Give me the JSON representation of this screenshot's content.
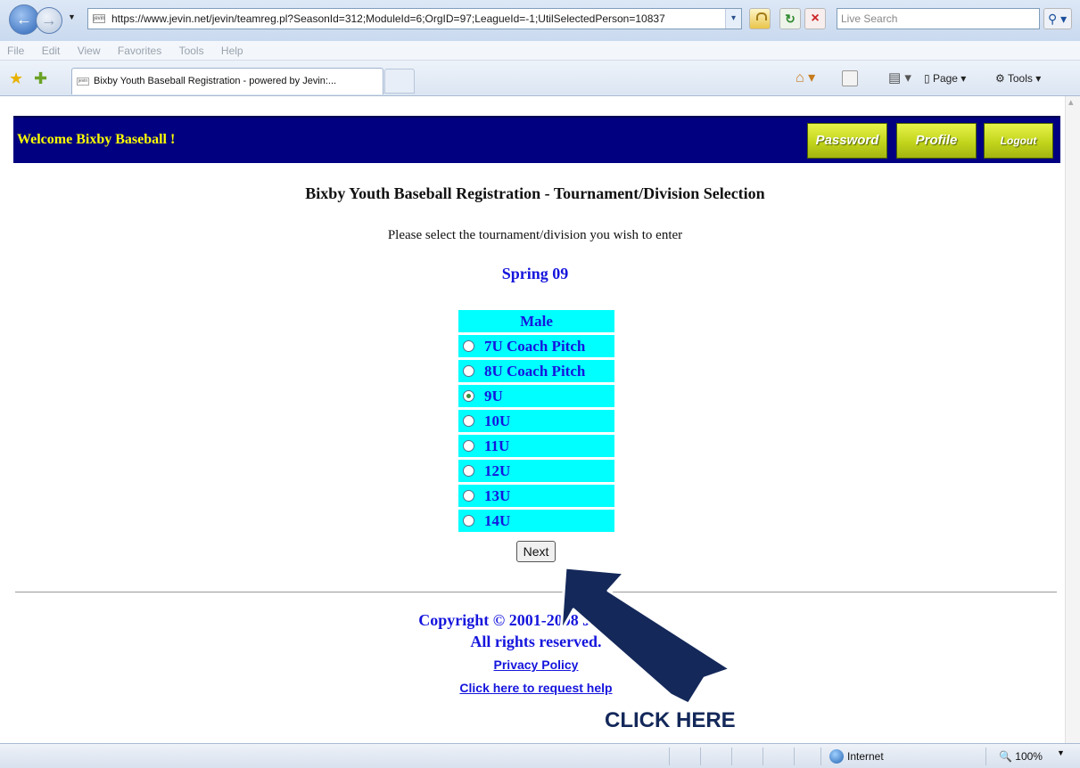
{
  "browser": {
    "url": "https://www.jevin.net/jevin/teamreg.pl?SeasonId=312;ModuleId=6;OrgID=97;LeagueId=-1;UtilSelectedPerson=10837",
    "search_placeholder": "Live Search",
    "menu": [
      "File",
      "Edit",
      "View",
      "Favorites",
      "Tools",
      "Help"
    ],
    "tab_title": "Bixby Youth Baseball Registration - powered by Jevin:...",
    "page_menu": "Page",
    "tools_menu": "Tools",
    "status_zone": "Internet",
    "zoom": "100%"
  },
  "header": {
    "welcome": "Welcome Bixby Baseball !",
    "password_label": "Password",
    "profile_label": "Profile",
    "logout_label": "Logout",
    "bg_color": "#000080",
    "welcome_color": "#ffff00"
  },
  "main": {
    "title": "Bixby Youth Baseball Registration - Tournament/Division Selection",
    "instructions": "Please select the tournament/division you wish to enter",
    "season": "Spring 09",
    "division_group": "Male",
    "divisions": [
      {
        "label": "7U Coach Pitch",
        "selected": false
      },
      {
        "label": "8U Coach Pitch",
        "selected": false
      },
      {
        "label": "9U",
        "selected": true
      },
      {
        "label": "10U",
        "selected": false
      },
      {
        "label": "11U",
        "selected": false
      },
      {
        "label": "12U",
        "selected": false
      },
      {
        "label": "13U",
        "selected": false
      },
      {
        "label": "14U",
        "selected": false
      }
    ],
    "next_label": "Next",
    "accent_color": "#00ffff"
  },
  "footer": {
    "copyright_line1": "Copyright © 2001-2008 Jevin, Inc.",
    "copyright_line2": "All rights reserved.",
    "privacy_link": "Privacy Policy",
    "help_link": "Click here to request help"
  },
  "annotation": {
    "label": "CLICK HERE",
    "color": "#14285a"
  }
}
